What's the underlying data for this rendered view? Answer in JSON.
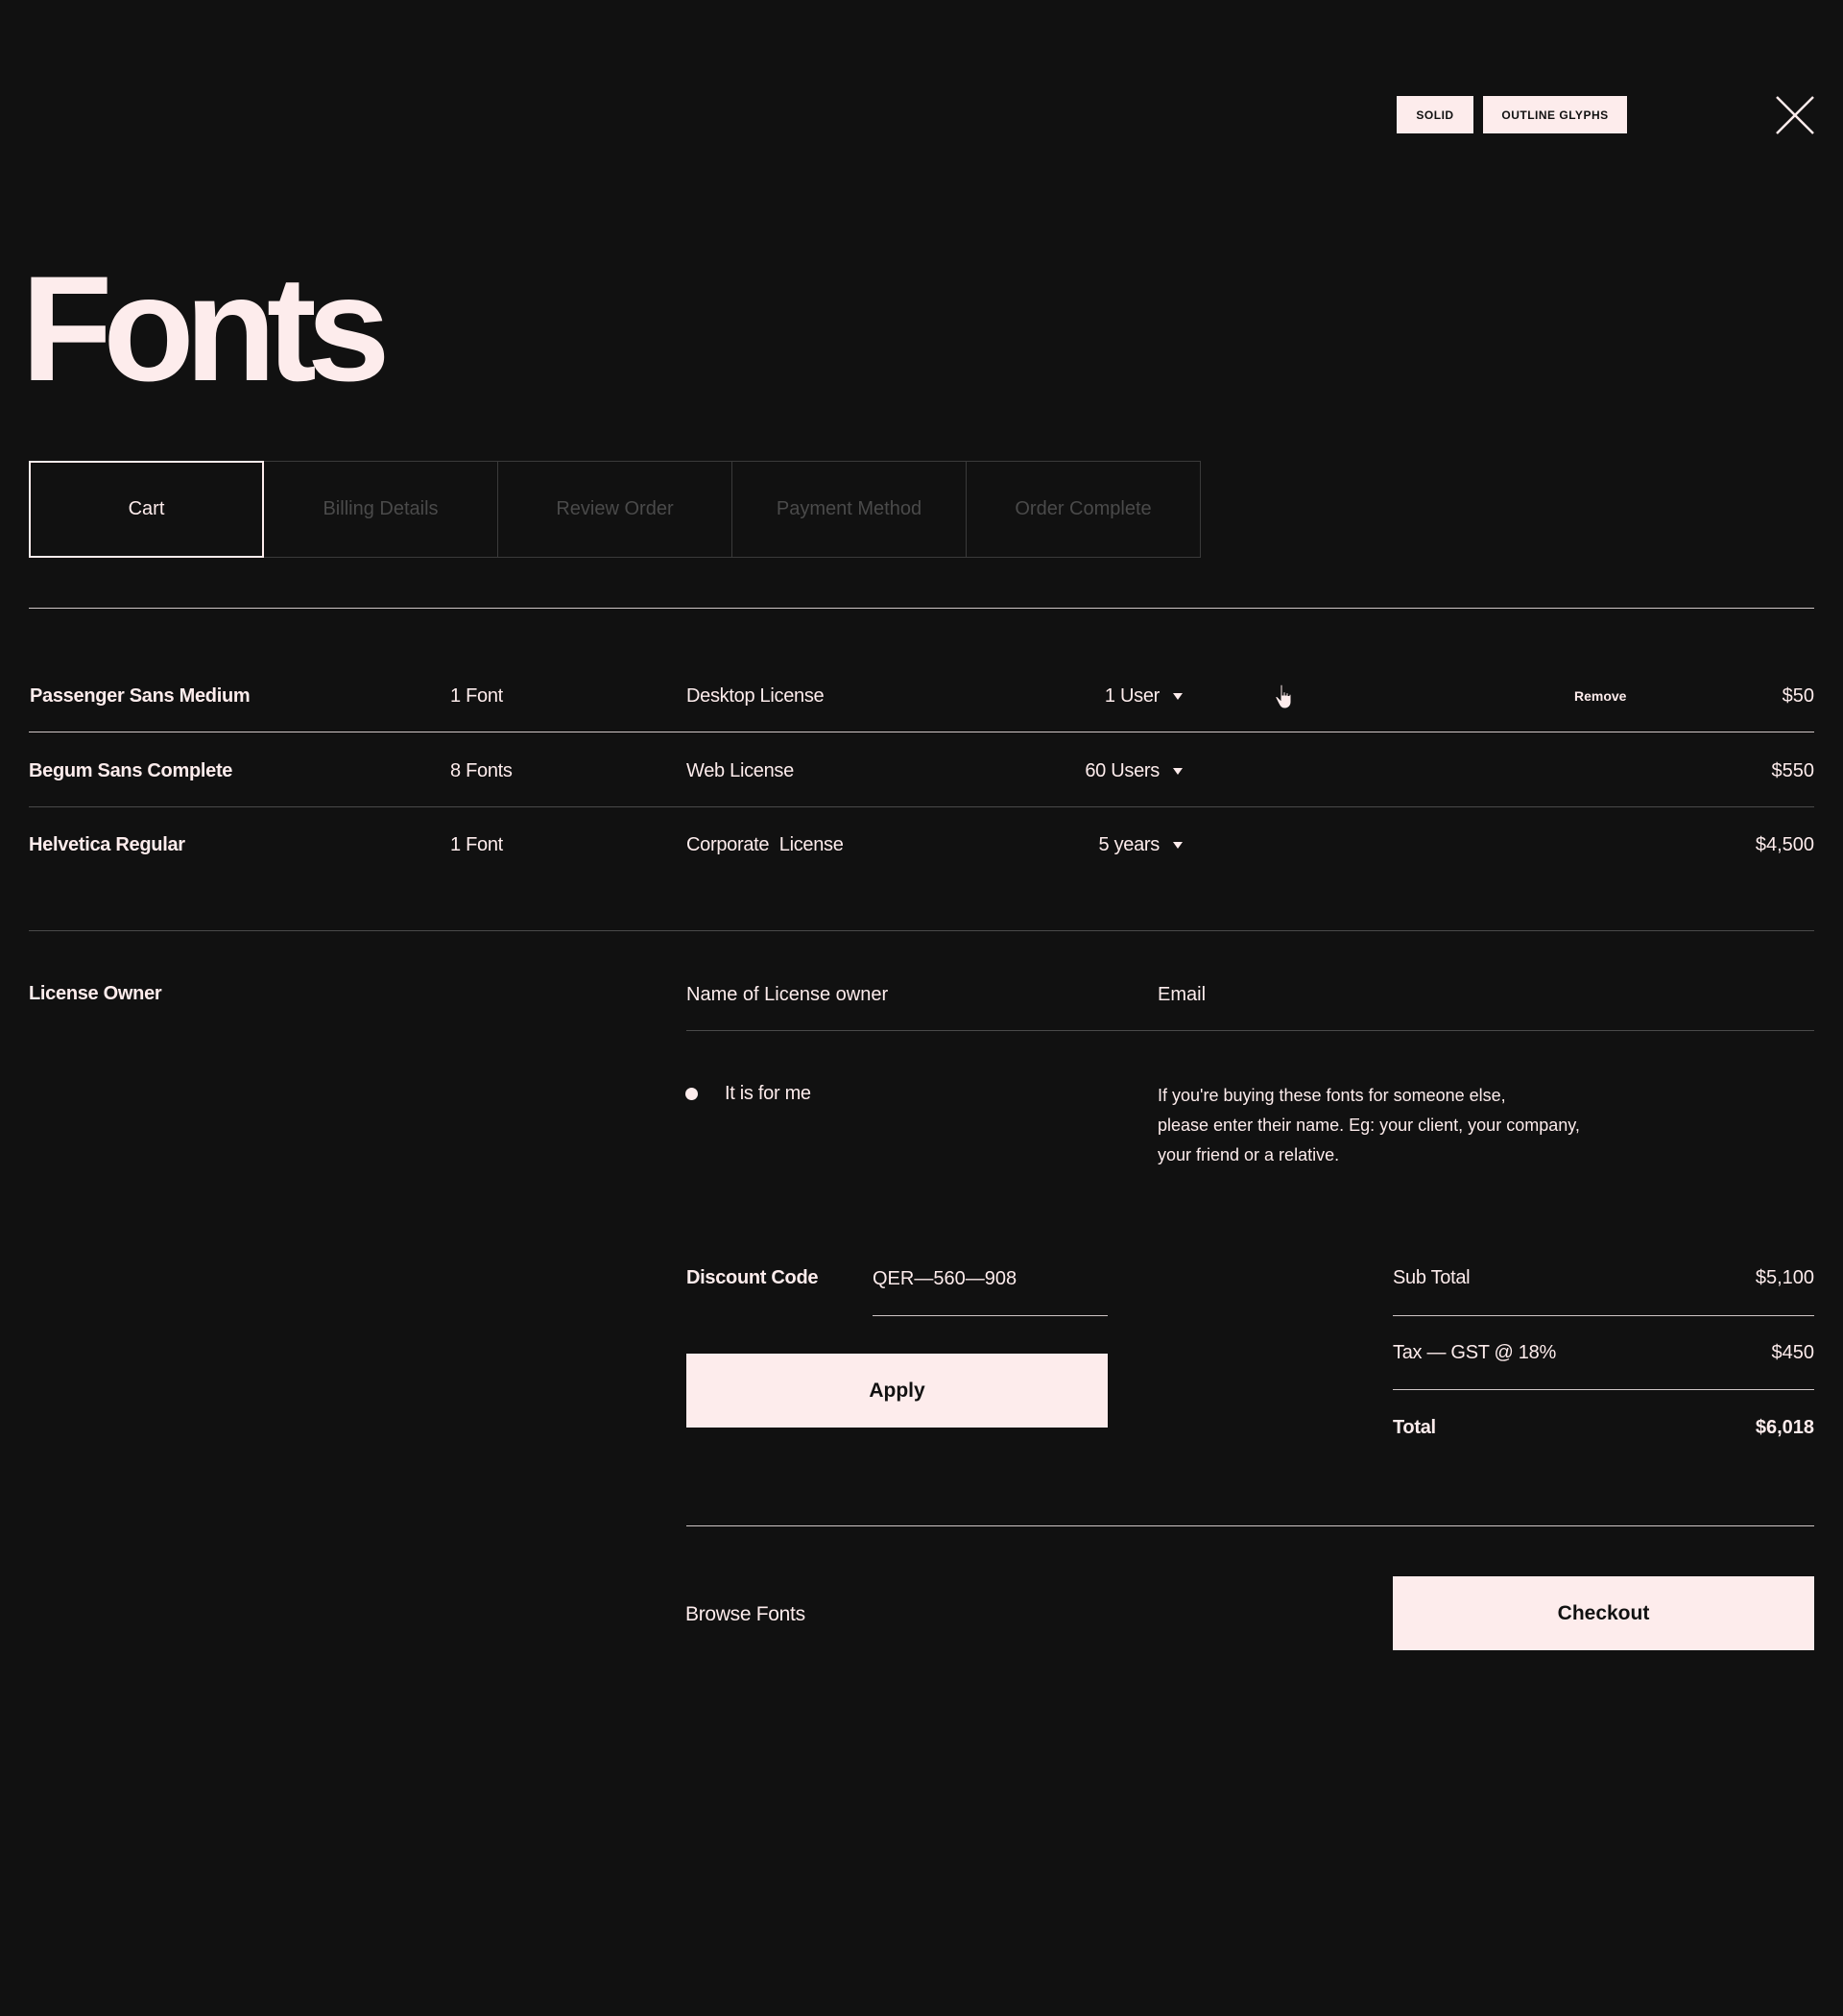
{
  "header": {
    "toggle_solid": "SOLID",
    "toggle_outline": "OUTLINE GLYPHS",
    "title": "Fonts"
  },
  "steps": [
    {
      "label": "Cart",
      "active": true
    },
    {
      "label": "Billing Details",
      "active": false
    },
    {
      "label": "Review Order",
      "active": false
    },
    {
      "label": "Payment Method",
      "active": false
    },
    {
      "label": "Order Complete",
      "active": false
    }
  ],
  "cart": {
    "remove_label": "Remove",
    "items": [
      {
        "name": "Passenger Sans Medium",
        "count": "1 Font",
        "license": "Desktop License",
        "quantity": "1 User",
        "price": "$50"
      },
      {
        "name": "Begum Sans Complete",
        "count": "8 Fonts",
        "license": "Web License",
        "quantity": "60 Users",
        "price": "$550"
      },
      {
        "name": "Helvetica Regular",
        "count": "1 Font",
        "license": "Corporate  License",
        "quantity": "5 years",
        "price": "$4,500"
      }
    ]
  },
  "license_owner": {
    "label": "License Owner",
    "name_placeholder": "Name of License owner",
    "email_placeholder": "Email",
    "radio_label": "It is for me",
    "help_lines": [
      "If you're buying these fonts for someone else,",
      "please enter their name. Eg: your client, your company,",
      "your friend or a relative."
    ]
  },
  "discount": {
    "label": "Discount Code",
    "value": "QER—560—908",
    "apply_label": "Apply"
  },
  "summary": {
    "subtotal_label": "Sub Total",
    "subtotal_value": "$5,100",
    "tax_label": "Tax — GST @ 18%",
    "tax_value": "$450",
    "total_label": "Total",
    "total_value": "$6,018"
  },
  "footer": {
    "browse_label": "Browse Fonts",
    "checkout_label": "Checkout"
  }
}
